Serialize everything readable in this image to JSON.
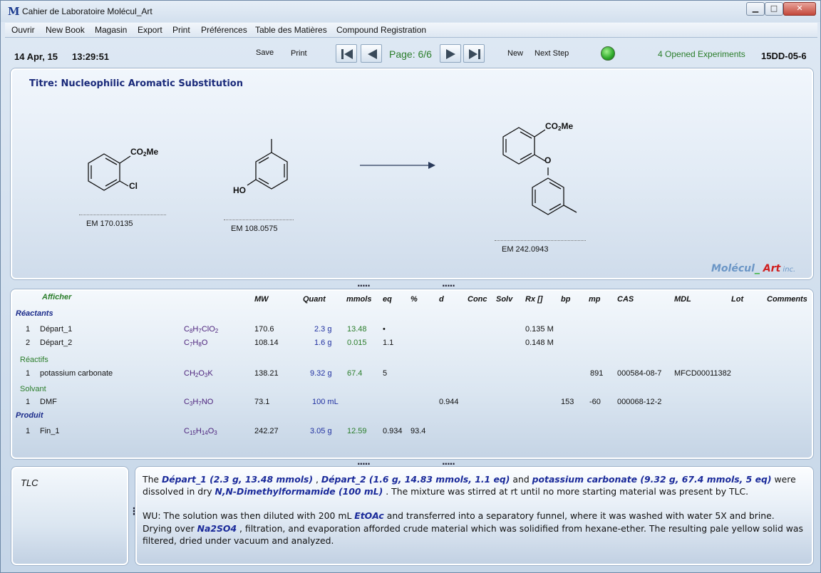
{
  "window": {
    "title": "Cahier de Laboratoire Molécul_Art",
    "logo_letter": "M",
    "min_glyph": "▁",
    "max_glyph": "□",
    "close_glyph": "✕"
  },
  "menu": [
    "Ouvrir",
    "New Book",
    "Magasin",
    "Export",
    "Print",
    "Préférences",
    "Table des Matières",
    "Compound Registration"
  ],
  "toolbar": {
    "date": "14 Apr, 15",
    "time": "13:29:51",
    "save_label": "Save",
    "print_label": "Print",
    "page_indicator": "Page: 6/6",
    "new_label": "New",
    "next_step_label": "Next Step",
    "opened_experiments": "4 Opened Experiments",
    "experiment_code": "15DD-05-6",
    "status_color": "#2ea82a"
  },
  "splitter": ".....",
  "scheme": {
    "title": "Titre: Nucleophilic Aromatic Substitution",
    "reactant1": {
      "label_co2me": "CO",
      "sub": "2",
      "me": "Me",
      "label_cl": "Cl",
      "em": "EM 170.0135"
    },
    "reactant2": {
      "label_ho": "HO",
      "em": "EM 108.0575"
    },
    "product": {
      "label_co2me": "CO",
      "sub": "2",
      "me": "Me",
      "label_o": "O",
      "em": "EM 242.0943"
    },
    "brand": {
      "part1": "Molécul",
      "part2": "_",
      "part3": " Art",
      "part4": " inc."
    }
  },
  "table": {
    "afficher": "Afficher",
    "headers": [
      "MW",
      "Quant",
      "mmols",
      "eq",
      "%",
      "d",
      "Conc",
      "Solv",
      "Rx []",
      "bp",
      "mp",
      "CAS",
      "MDL",
      "Lot",
      "Comments"
    ],
    "sections": {
      "reactants": "Réactants",
      "reagents": "Réactifs",
      "solvent": "Solvant",
      "product": "Produit"
    },
    "rows": {
      "depart1": {
        "n": "1",
        "name": "Départ_1",
        "formula": [
          "C",
          "8",
          "H",
          "7",
          "ClO",
          "2"
        ],
        "mw": "170.6",
        "quant": "2.3 g",
        "mmols": "13.48",
        "eq": "•",
        "rx": "0.135 M"
      },
      "depart2": {
        "n": "2",
        "name": "Départ_2",
        "formula": [
          "C",
          "7",
          "H",
          "8",
          "O",
          ""
        ],
        "mw": "108.14",
        "quant": "1.6 g",
        "mmols": "0.015",
        "eq": "1.1",
        "rx": "0.148 M"
      },
      "k2co3": {
        "n": "1",
        "name": "potassium carbonate",
        "formula": [
          "CH",
          "2",
          "O",
          "3",
          "K",
          ""
        ],
        "mw": "138.21",
        "quant": "9.32 g",
        "mmols": "67.4",
        "eq": "5",
        "mp": "891",
        "cas": "000584-08-7",
        "mdl": "MFCD00011382"
      },
      "dmf": {
        "n": "1",
        "name": "DMF",
        "formula": [
          "C",
          "3",
          "H",
          "7",
          "NO",
          ""
        ],
        "mw": "73.1",
        "quant": "100 mL",
        "d": "0.944",
        "bp": "153",
        "mp": "-60",
        "cas": "000068-12-2"
      },
      "fin1": {
        "n": "1",
        "name": "Fin_1",
        "formula": [
          "C",
          "15",
          "H",
          "14",
          "O",
          "3"
        ],
        "mw": "242.27",
        "quant": "3.05 g",
        "mmols": "12.59",
        "eq": "0.934",
        "pct": "93.4"
      }
    }
  },
  "tlc": {
    "label": "TLC"
  },
  "procedure": {
    "p1_a": "The ",
    "p1_b": "Départ_1 (2.3 g, 13.48 mmols)",
    "p1_c": " , ",
    "p1_d": "Départ_2 (1.6 g, 14.83 mmols, 1.1 eq)",
    "p1_e": "  and ",
    "p1_f": "potassium carbonate (9.32 g, 67.4 mmols, 5 eq)",
    "p1_g": "  were dissolved in dry ",
    "p1_h": "N,N-Dimethylformamide (100 mL)",
    "p1_i": " . The mixture was stirred at rt until no more starting material was present by TLC.",
    "p2_a": "WU: The solution was then diluted  with 200 mL ",
    "p2_b": "EtOAc",
    "p2_c": " and transferred into a separatory funnel, where it was washed with water 5X and brine. Drying over ",
    "p2_d": "Na2SO4",
    "p2_e": " , filtration, and evaporation afforded crude material which was solidified from hexane-ether. The resulting pale yellow solid was filtered, dried under vacuum and analyzed."
  }
}
